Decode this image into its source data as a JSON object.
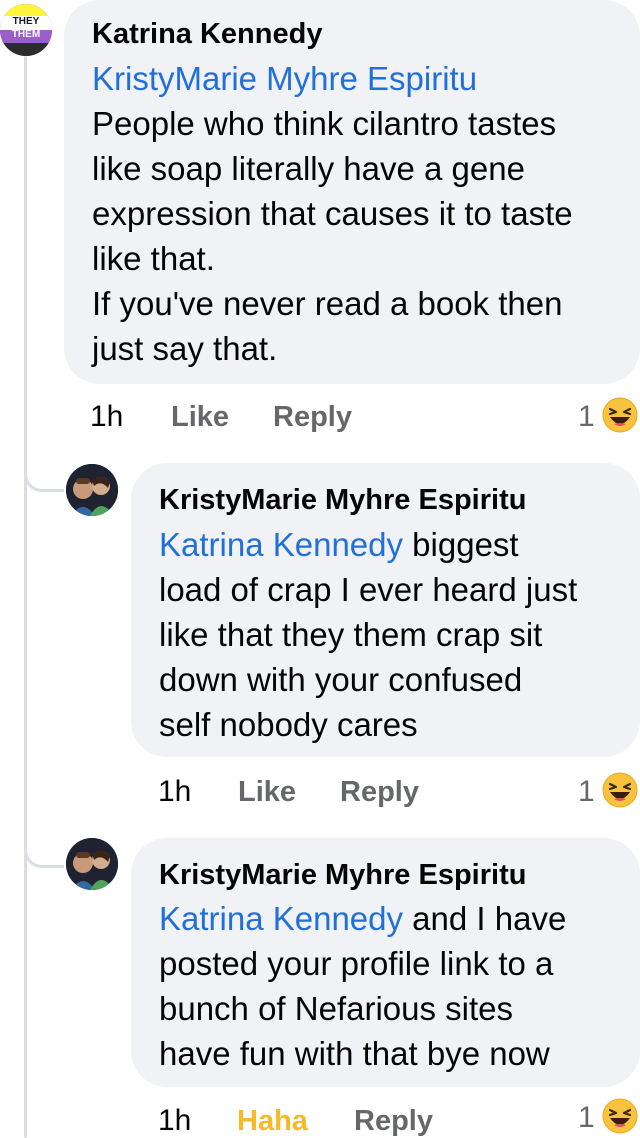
{
  "main_comment": {
    "badge_top": "THEY",
    "badge_bottom": "THEM",
    "author": "Katrina Kennedy",
    "lines": [
      {
        "mention": "KristyMarie Myhre Espiritu",
        "text": ""
      },
      {
        "mention": "",
        "text": "People who think cilantro tastes"
      },
      {
        "mention": "",
        "text": "like soap literally have a gene"
      },
      {
        "mention": "",
        "text": "expression that causes it to taste"
      },
      {
        "mention": "",
        "text": "like that."
      },
      {
        "mention": "",
        "text": "If you've never read a book then"
      },
      {
        "mention": "",
        "text": "just say that."
      }
    ],
    "time": "1h",
    "like": "Like",
    "reply": "Reply",
    "reaction_count": "1",
    "reaction_icon": "laughing-emoji-icon"
  },
  "reply_1": {
    "author": "KristyMarie Myhre Espiritu",
    "lines": [
      {
        "mention": "Katrina Kennedy",
        "text": " biggest"
      },
      {
        "mention": "",
        "text": "load of crap I ever heard just"
      },
      {
        "mention": "",
        "text": "like that they them crap sit"
      },
      {
        "mention": "",
        "text": "down with your confused"
      },
      {
        "mention": "",
        "text": "self nobody cares"
      }
    ],
    "time": "1h",
    "like": "Like",
    "reply": "Reply",
    "reaction_count": "1",
    "reaction_icon": "laughing-emoji-icon"
  },
  "reply_2": {
    "author": "KristyMarie Myhre Espiritu",
    "lines": [
      {
        "mention": "Katrina Kennedy",
        "text": " and I have"
      },
      {
        "mention": "",
        "text": "posted your profile link to a"
      },
      {
        "mention": "",
        "text": "bunch of Nefarious sites"
      },
      {
        "mention": "",
        "text": "have fun with that bye now"
      }
    ],
    "time": "1h",
    "like": "Haha",
    "reply": "Reply",
    "reaction_count": "1",
    "reaction_icon": "laughing-emoji-icon"
  },
  "colors": {
    "mention": "#216fdb",
    "bubble": "#f0f2f5",
    "haha_active": "#f7b928",
    "meta": "#65676b"
  }
}
